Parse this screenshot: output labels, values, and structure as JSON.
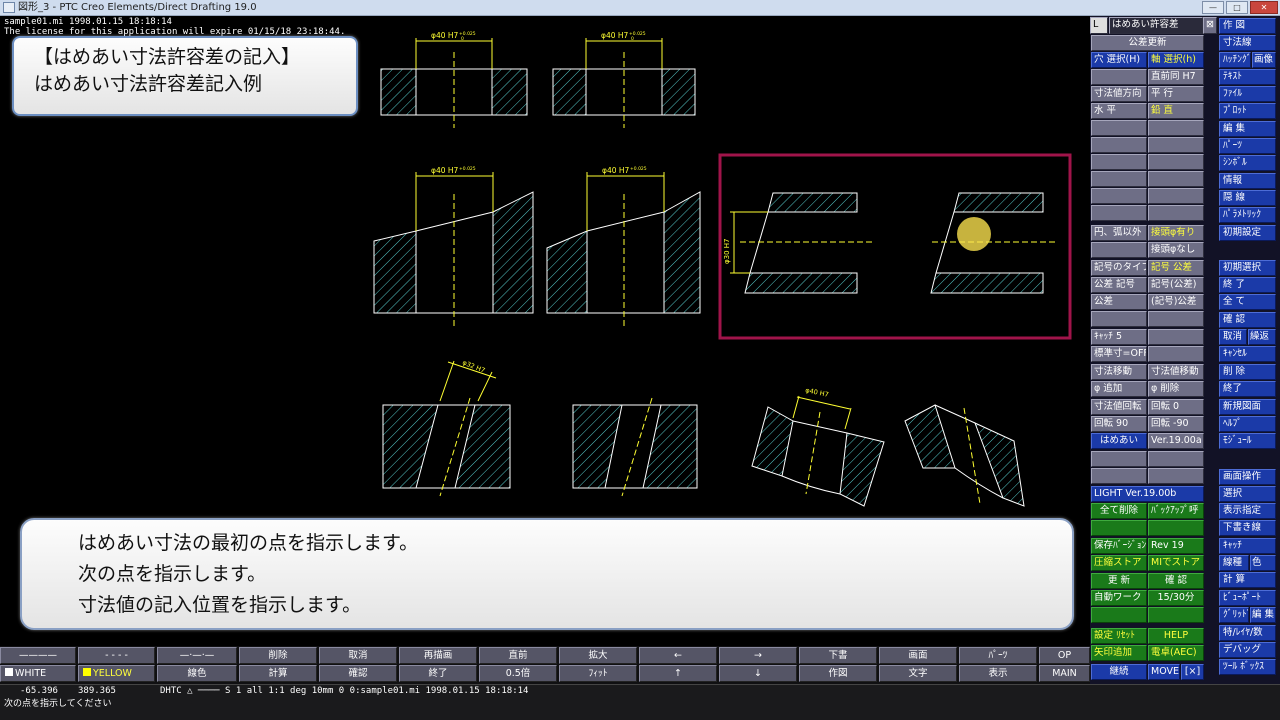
{
  "window": {
    "title": "図形_3 - PTC Creo Elements/Direct Drafting 19.0",
    "minimize": "—",
    "maximize": "□",
    "close": "✕"
  },
  "canvas": {
    "info_line1": "sample01.mi      1998.01.15 18:18:14",
    "info_line2": "The license for this application will expire 01/15/18 23:18:44.",
    "dimension_label": "φ40 H7",
    "dimension_label_30": "φ30 H7",
    "dimension_label_32": "φ32 H7",
    "tolerance_upper": "+0.025",
    "tolerance_lower": "0"
  },
  "callout_top": {
    "line1": "【はめあい寸法許容差の記入】",
    "line2": "はめあい寸法許容差記入例"
  },
  "callout_bottom": {
    "line1": "はめあい寸法の最初の点を指示します。",
    "line2": "次の点を指示します。",
    "line3": "寸法値の記入位置を指示します。"
  },
  "menu": {
    "header_left": "L",
    "header_title": "はめあい許容差",
    "header_close": "⊠",
    "tolerance_update": "公差更新",
    "hole_select": "穴 選択(H)",
    "shaft_select": "軸 選択(h)",
    "immediately_same": "直前同 H7",
    "dim_direction": "寸法値方向",
    "parallel": "平 行",
    "horizontal": "水 平",
    "vertical": "鉛 直",
    "except_arc": "円、弧以外",
    "with_prefix": "接頭φ有り",
    "without_prefix": "接頭φなし",
    "symbol_type": "記号のタイプ",
    "symbol_tolerance": "記号 公差",
    "tolerance_symbol": "公差 記号",
    "symbol_paren": "記号(公差)",
    "tolerance": "公差",
    "paren_symbol": "(記号)公差",
    "catch": "ｷｬｯﾁ 5",
    "standard_dim": "標準寸=OFF",
    "dim_move": "寸法移動",
    "dim_value_move": "寸法値移動",
    "phi_add": "φ 追加",
    "phi_delete": "φ 削除",
    "dim_rotate": "寸法値回転",
    "rotate_0": "回転 0",
    "rotate_90": "回転 90",
    "rotate_m90": "回転 -90",
    "fit": "はめあい",
    "version": "Ver.19.00a",
    "light_header": "LIGHT Ver.19.00b",
    "delete_all": "全て削除",
    "backup": "ﾊﾞｯｸｱｯﾌﾟ呼",
    "save_version": "保存ﾊﾞｰｼﾞｮﾝ",
    "rev": "Rev 19",
    "compress_store": "圧縮ストア",
    "mi_store": "MIでストア",
    "update": "更 新",
    "confirm": "確 認",
    "auto_work": "自動ワーク",
    "minutes": "15/30分",
    "settings_reset": "設定 ﾘｾｯﾄ",
    "help": "HELP",
    "arrow_add": "矢印追加",
    "calculator": "電卓(AEC)",
    "continue": "継続",
    "move": "MOVE",
    "close_x": "[×]"
  },
  "rmenu": {
    "r1": "作 図",
    "r2": "寸法線",
    "r3a": "ﾊｯﾁﾝｸﾞ",
    "r3b": "画像",
    "r4": "ﾃｷｽﾄ",
    "r5": "ﾌｧｲﾙ",
    "r6": "ﾌﾟﾛｯﾄ",
    "r7": "編 集",
    "r8": "ﾊﾟｰﾂ",
    "r9": "ｼﾝﾎﾞﾙ",
    "r10": "情報",
    "r11": "隠 線",
    "r12": "ﾊﾟﾗﾒﾄﾘｯｸ",
    "r13": "初期設定",
    "r14": "初期選択",
    "r15": "終 了",
    "r16": "全 て",
    "r17": "確 認",
    "r18a": "取消",
    "r18b": "繰返",
    "r19": "ｷｬﾝｾﾙ",
    "r20": "削 除",
    "r21": "終了",
    "r22": "新規図面",
    "r23": "ﾍﾙﾌﾟ",
    "r24": "ﾓｼﾞｭｰﾙ",
    "r25": "画面操作",
    "r26": "選択",
    "r27": "表示指定",
    "r28": "下書き線",
    "r29": "ｷｬｯﾁ",
    "r30a": "線種",
    "r30b": "色",
    "r31": "計 算",
    "r32": "ﾋﾞｭｰﾎﾟｰﾄ",
    "r33a": "ｸﾞﾘｯﾄﾞ",
    "r33b": "編 集",
    "r34": "特/ﾚｲﾔ/数",
    "r35": "デバッグ",
    "r36": "ﾂｰﾙ ﾎﾞｯｸｽ"
  },
  "bottombar": {
    "line_solid": "————",
    "line_dash": "- - - -",
    "line_chain": "—·—·—",
    "delete": "削除",
    "cancel": "取消",
    "redraw": "再描画",
    "previous": "直前",
    "zoom": "拡大",
    "left": "←",
    "right": "→",
    "draft": "下書",
    "screen": "画面",
    "parts": "ﾊﾟｰﾂ",
    "op": "OP",
    "white": "WHITE",
    "yellow": "YELLOW",
    "line_color": "線色",
    "calculate": "計算",
    "confirm": "確認",
    "end": "終了",
    "half": "0.5倍",
    "fit": "ﾌｨｯﾄ",
    "up": "↑",
    "down": "↓",
    "drawing": "作図",
    "text": "文字",
    "display": "表示",
    "main": "MAIN",
    "color_white": "#ffffff",
    "color_yellow": "#ffff00"
  },
  "status": {
    "coord_x": "-65.396",
    "coord_y": "389.365",
    "info": "DHTC △ ──── S 1    all  1:1     deg      10mm       0 0:sample01.mi      1998.01.15 18:18:14",
    "prompt": "次の点を指示してください"
  },
  "colors": {
    "drawing_lines": "#ffffff",
    "dimension": "#ffff32",
    "hatch": "#55c8c8",
    "highlight_frame": "#a0144a",
    "cursor": "#ffe650"
  }
}
